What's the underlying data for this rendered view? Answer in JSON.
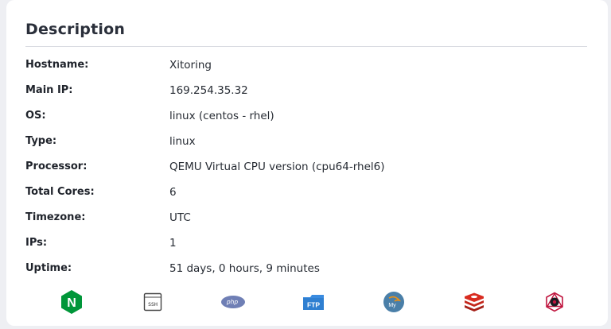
{
  "section": {
    "title": "Description"
  },
  "fields": [
    {
      "label": "Hostname:",
      "value": "Xitoring"
    },
    {
      "label": "Main IP:",
      "value": "169.254.35.32"
    },
    {
      "label": "OS:",
      "value": "linux (centos - rhel)"
    },
    {
      "label": "Type:",
      "value": "linux"
    },
    {
      "label": "Processor:",
      "value": "QEMU Virtual CPU version (cpu64-rhel6)"
    },
    {
      "label": "Total Cores:",
      "value": "6"
    },
    {
      "label": "Timezone:",
      "value": "UTC"
    },
    {
      "label": "IPs:",
      "value": "1"
    },
    {
      "label": "Uptime:",
      "value": "51 days, 0 hours, 9 minutes"
    }
  ],
  "services": [
    {
      "icon": "nginx-icon",
      "text": "N",
      "color": "#009639"
    },
    {
      "icon": "ssh-icon",
      "text": "SSH",
      "color": "#555555"
    },
    {
      "icon": "php-icon",
      "text": "php",
      "color": "#6f7fb5"
    },
    {
      "icon": "ftp-icon",
      "text": "FTP",
      "color": "#2f7fd1"
    },
    {
      "icon": "mysql-icon",
      "text": "My",
      "color": "#4a7fa8"
    },
    {
      "icon": "redis-icon",
      "color": "#d82c20"
    },
    {
      "icon": "graphql-icon",
      "color": "#c0163f"
    }
  ]
}
